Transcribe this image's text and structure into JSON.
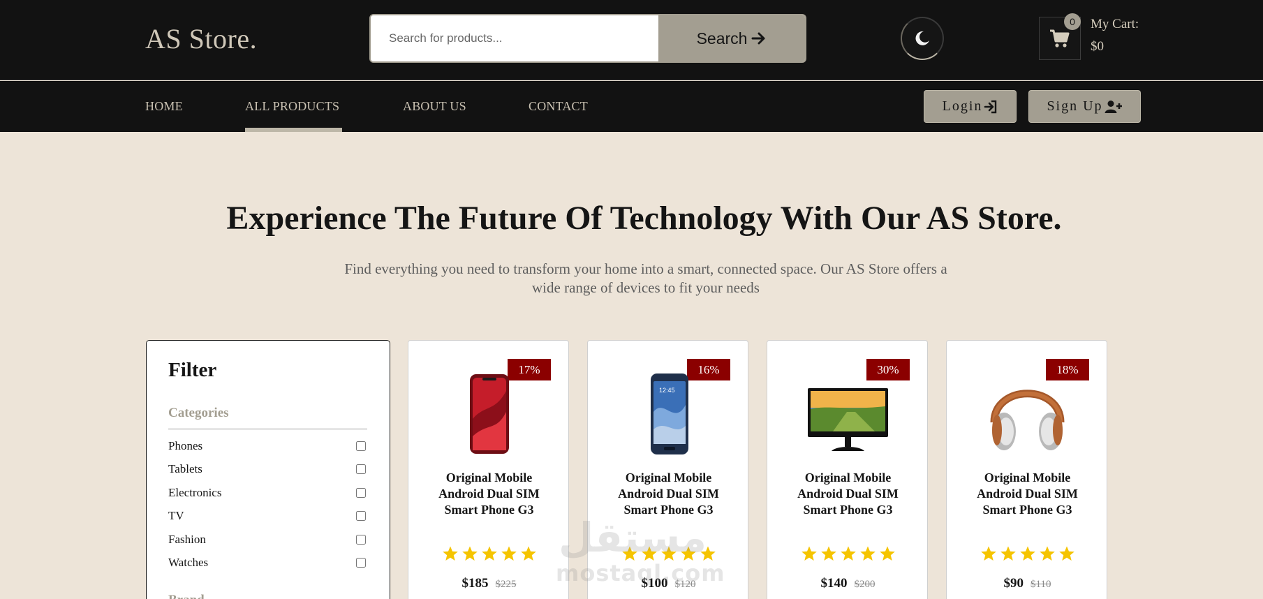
{
  "header": {
    "logo": "AS Store.",
    "search": {
      "placeholder": "Search for products...",
      "value": "",
      "button_label": "Search"
    },
    "theme_icon": "moon-icon",
    "cart": {
      "icon": "cart-icon",
      "count": "0",
      "label": "My Cart:",
      "total": "$0"
    }
  },
  "nav": {
    "links": [
      {
        "label": "HOME",
        "active": false
      },
      {
        "label": "ALL PRODUCTS",
        "active": true
      },
      {
        "label": "ABOUT US",
        "active": false
      },
      {
        "label": "CONTACT",
        "active": false
      }
    ],
    "login_label": "Login",
    "login_icon": "sign-in-icon",
    "signup_label": "Sign Up",
    "signup_icon": "user-plus-icon"
  },
  "hero": {
    "title": "Experience The Future Of Technology With Our AS Store.",
    "subtitle": "Find everything you need to transform your home into a smart, connected space. Our AS Store offers a wide range of devices to fit your needs"
  },
  "filter": {
    "title": "Filter",
    "categories_heading": "Categories",
    "categories": [
      {
        "label": "Phones",
        "checked": false
      },
      {
        "label": "Tablets",
        "checked": false
      },
      {
        "label": "Electronics",
        "checked": false
      },
      {
        "label": "TV",
        "checked": false
      },
      {
        "label": "Fashion",
        "checked": false
      },
      {
        "label": "Watches",
        "checked": false
      }
    ],
    "brand_heading": "Brand"
  },
  "products": [
    {
      "name": "Original Mobile Android Dual SIM Smart Phone G3",
      "discount": "17%",
      "price": "$185",
      "old_price": "$225",
      "rating": 5,
      "image": "red-smartphone"
    },
    {
      "name": "Original Mobile Android Dual SIM Smart Phone G3",
      "discount": "16%",
      "price": "$100",
      "old_price": "$120",
      "rating": 5,
      "image": "blue-smartphone"
    },
    {
      "name": "Original Mobile Android Dual SIM Smart Phone G3",
      "discount": "30%",
      "price": "$140",
      "old_price": "$200",
      "rating": 5,
      "image": "monitor"
    },
    {
      "name": "Original Mobile Android Dual SIM Smart Phone G3",
      "discount": "18%",
      "price": "$90",
      "old_price": "$110",
      "rating": 5,
      "image": "headphones"
    }
  ],
  "watermark": {
    "arabic": "مستقل",
    "latin": "mostaql.com"
  },
  "colors": {
    "header_bg": "#121212",
    "page_bg": "#ede4d8",
    "accent": "#a39e91",
    "discount_bg": "#8b0000",
    "star": "#f5c400"
  }
}
